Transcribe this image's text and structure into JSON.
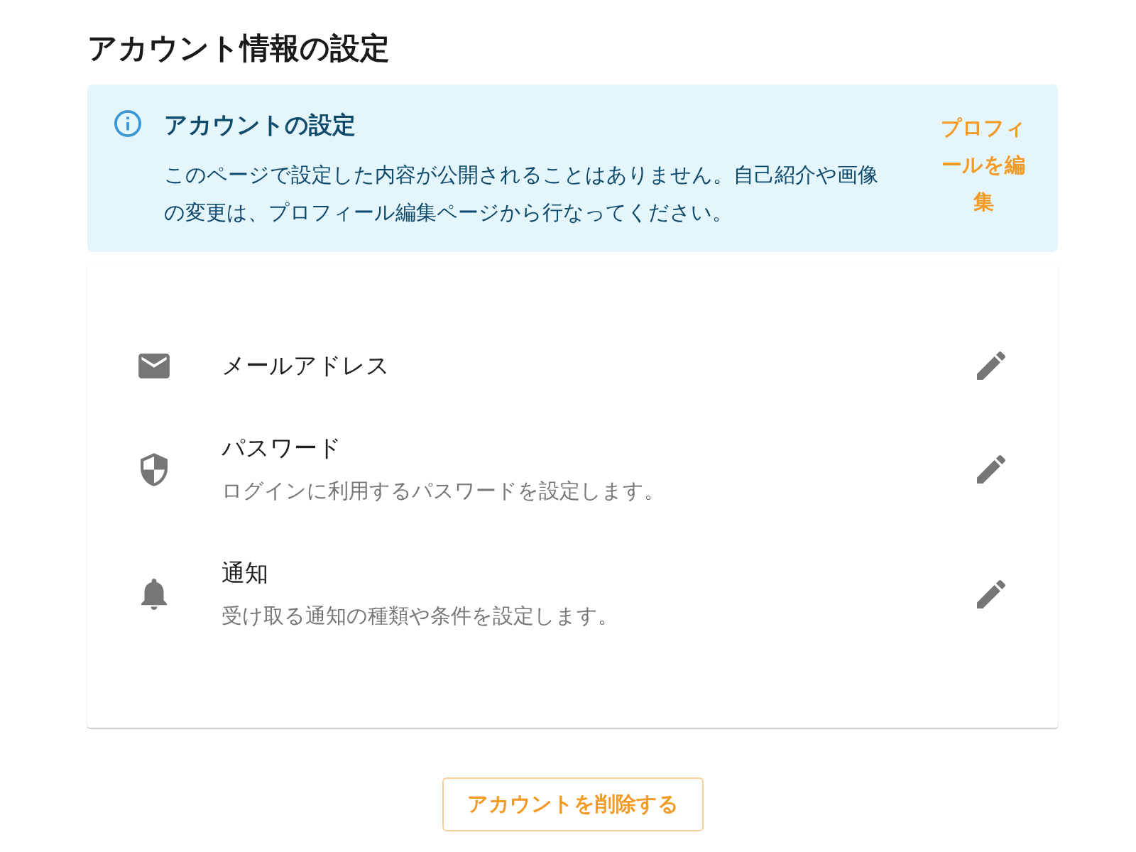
{
  "page_title": "アカウント情報の設定",
  "notice": {
    "kind": "info",
    "title": "アカウントの設定",
    "message": "このページで設定した内容が公開されることはありません。自己紹介や画像の変更は、プロフィール編集ページから行なってください。",
    "link": "プロフィールを編集"
  },
  "settings": [
    {
      "kind": "email",
      "title": "メールアドレス"
    },
    {
      "kind": "password",
      "title": "パスワード",
      "description": "ログインに利用するパスワードを設定します。"
    },
    {
      "kind": "notifications",
      "title": "通知",
      "description": "受け取る通知の種類や条件を設定します。"
    }
  ],
  "delete_button": "アカウントを削除する"
}
